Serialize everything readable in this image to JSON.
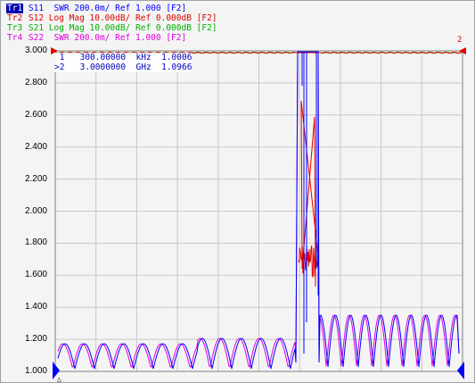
{
  "traces": [
    {
      "tag": "Tr1",
      "text": " S11  SWR 200.0m/ Ref 1.000 [F2]",
      "color": "#0000ff",
      "active": true
    },
    {
      "tag": "Tr2",
      "text": " S12 Log Mag 10.00dB/ Ref 0.000dB [F2]",
      "color": "#e00000",
      "active": false
    },
    {
      "tag": "Tr3",
      "text": " S21 Log Mag 10.00dB/ Ref 0.000dB [F2]",
      "color": "#00b000",
      "active": false
    },
    {
      "tag": "Tr4",
      "text": " S22  SWR 200.0m/ Ref 1.000 [F2]",
      "color": "#e000e0",
      "active": false
    }
  ],
  "markers": {
    "line1": " 1   300.00000  kHz  1.0006",
    "line2": ">2   3.0000000  GHz  1.0966"
  },
  "y_axis": {
    "ticks": [
      "3.000",
      "2.800",
      "2.600",
      "2.400",
      "2.200",
      "2.000",
      "1.800",
      "1.600",
      "1.400",
      "1.200",
      "1.000"
    ]
  },
  "colors": {
    "grid": "#c8c8c8",
    "frame": "#808080",
    "marker_triangle": "#0000ff",
    "ref_arrow": "#e00000"
  }
}
